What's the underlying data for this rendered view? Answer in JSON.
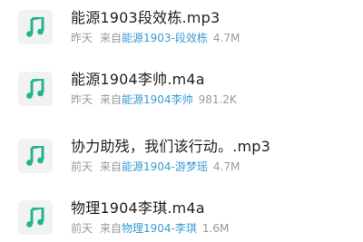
{
  "accent_color": "#1fb58f",
  "link_color": "#3a9bd5",
  "icon": "music-note-icon",
  "files": [
    {
      "name": "能源1903段效栋.mp3",
      "date": "昨天",
      "from_label": "来自",
      "source": "能源1903-段效栋",
      "size": "4.7M"
    },
    {
      "name": "能源1904李帅.m4a",
      "date": "昨天",
      "from_label": "来自",
      "source": "能源1904李帅",
      "size": "981.2K"
    },
    {
      "name": "协力助残，我们该行动。.mp3",
      "date": "前天",
      "from_label": "来自",
      "source": "能源1904-游梦瑶",
      "size": "4.7M"
    },
    {
      "name": "物理1904李琪.m4a",
      "date": "前天",
      "from_label": "来自",
      "source": "物理1904-李琪",
      "size": "1.6M"
    }
  ]
}
